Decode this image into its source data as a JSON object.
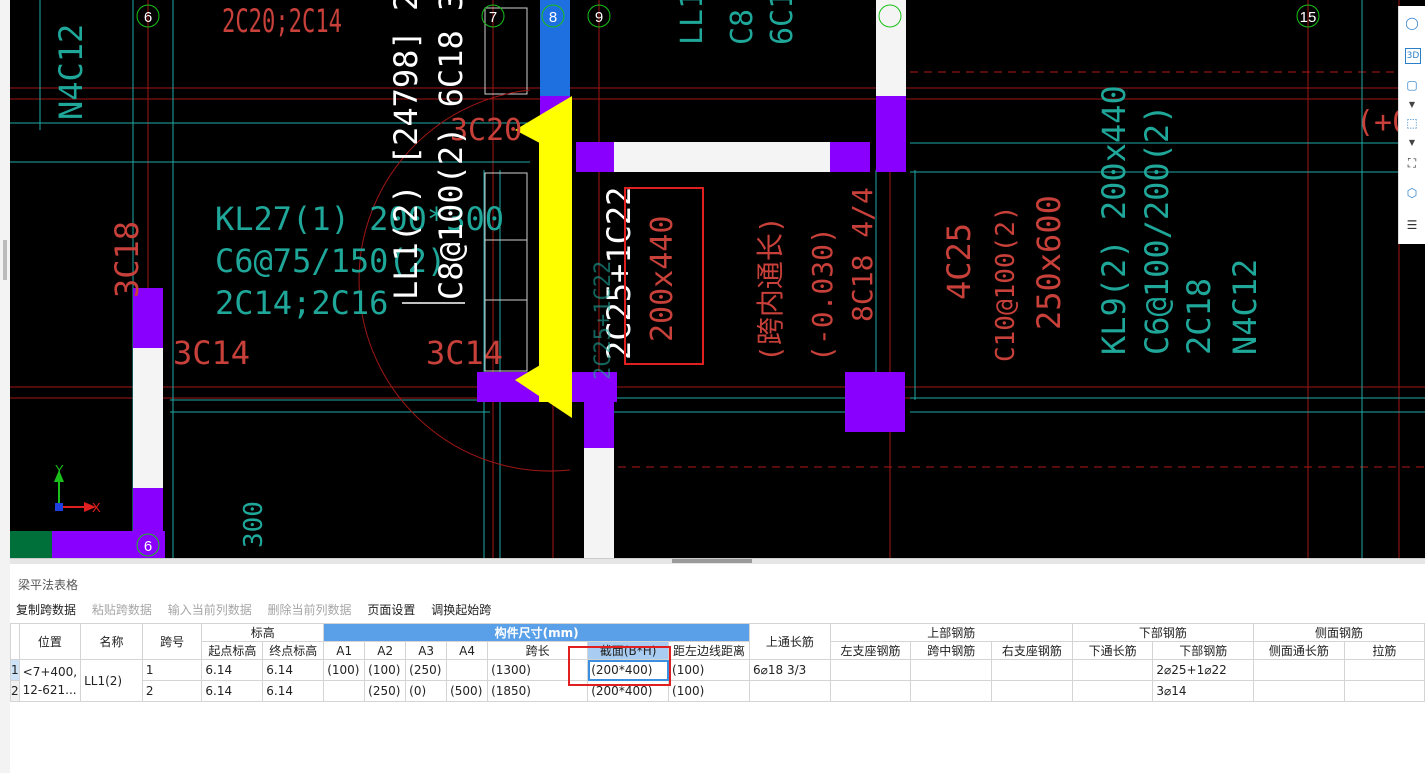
{
  "cad": {
    "axis_labels": [
      "6",
      "7",
      "8",
      "9",
      "15",
      "6"
    ],
    "texts": {
      "t_2c20_2c14": "2C20;2C14",
      "t_n4c12_left": "N4C12",
      "t_3c18": "3C18",
      "t_3c14_a": "3C14",
      "t_3c14_b": "3C14",
      "t_3c20": "3C20",
      "t_kl27_1": "KL27(1) 200*300",
      "t_kl27_2": "C6@75/150(2)",
      "t_kl27_3": "2C14;2C16",
      "t_ll1_1": "LL1(2) [24798] 200*400",
      "t_ll1_2": "C8@100(2) 6C18 3/3",
      "t_2c25": "2C25+1C22",
      "t_200x440": "200x440",
      "t_kuanei": "(跨内通长)",
      "t_0030": "(-0.030)",
      "t_8c18": "8C18 4/4",
      "t_4c25": "4C25",
      "t_c10": "C10@100(2)",
      "t_250x600": "250x600",
      "t_kl9_1": "KL9(2) 200x440",
      "t_kl9_2": "C6@100/200(2)",
      "t_kl9_3": "2C18",
      "t_kl9_4": "N4C12",
      "t_top_ll1": "LL1",
      "t_top_c8": "C8",
      "t_top_6c1": "6C1",
      "t_plus": "(+0",
      "t_300": "300",
      "t_2c25_small": "2C25+1C22"
    },
    "ucs": {
      "x": "X",
      "y": "Y"
    }
  },
  "right_tools": {
    "icons": [
      "orbit-icon",
      "view-3d-icon",
      "cube-front-icon",
      "cube-iso-icon",
      "fit-extent-icon",
      "view-cube-icon",
      "properties-icon"
    ],
    "label_3d": "3D"
  },
  "panel": {
    "title": "梁平法表格",
    "toolbar": {
      "copy": "复制跨数据",
      "paste": "粘贴跨数据",
      "input_col": "输入当前列数据",
      "delete_col": "删除当前列数据",
      "page_setup": "页面设置",
      "swap_start": "调换起始跨"
    },
    "headers": {
      "position": "位置",
      "name": "名称",
      "span_no": "跨号",
      "elevation": "标高",
      "start_elev": "起点标高",
      "end_elev": "终点标高",
      "size_group": "构件尺寸(mm)",
      "a1": "A1",
      "a2": "A2",
      "a3": "A3",
      "a4": "A4",
      "span_len": "跨长",
      "section": "截面(B*H)",
      "dist_left": "距左边线距离",
      "top_through": "上通长筋",
      "top_rebar": "上部钢筋",
      "left_support": "左支座钢筋",
      "mid_span": "跨中钢筋",
      "right_support": "右支座钢筋",
      "bottom_rebar": "下部钢筋",
      "bottom_through": "下通长筋",
      "bottom_bar": "下部钢筋",
      "side_rebar": "侧面钢筋",
      "side_through": "侧面通长筋",
      "tie_bar": "拉筋"
    },
    "rows": [
      {
        "num": "1",
        "position": "<7+400,",
        "position2": "12-621...",
        "name": "LL1(2)",
        "span": "1",
        "start": "6.14",
        "end": "6.14",
        "a1": "(100)",
        "a2": "(100)",
        "a3": "(250)",
        "a4": "",
        "len": "(1300)",
        "section": "(200*400)",
        "dist": "(100)",
        "top_through": "6⌀18 3/3",
        "left_support": "",
        "mid": "",
        "right_support": "",
        "bottom_through": "",
        "bottom": "2⌀25+1⌀22",
        "side_through": "",
        "tie": ""
      },
      {
        "num": "2",
        "span": "2",
        "start": "6.14",
        "end": "6.14",
        "a1": "",
        "a2": "(250)",
        "a3": "(0)",
        "a4": "(500)",
        "len": "(1850)",
        "section": "(200*400)",
        "dist": "(100)",
        "top_through": "",
        "left_support": "",
        "mid": "",
        "right_support": "",
        "bottom_through": "",
        "bottom": "3⌀14",
        "side_through": "",
        "tie": ""
      }
    ]
  },
  "colors": {
    "cad_bg": "#000000",
    "grid_red": "#b01818",
    "grid_cyan": "#20b2b2",
    "rebar_text": "#c8403a",
    "beam_text": "#1fa79a",
    "column_purple": "#8a00ff",
    "highlight_yellow": "#ffff00",
    "selected_blue": "#1e6fe0",
    "header_blue": "#5aa0e8",
    "annotation_red": "#e02020"
  }
}
